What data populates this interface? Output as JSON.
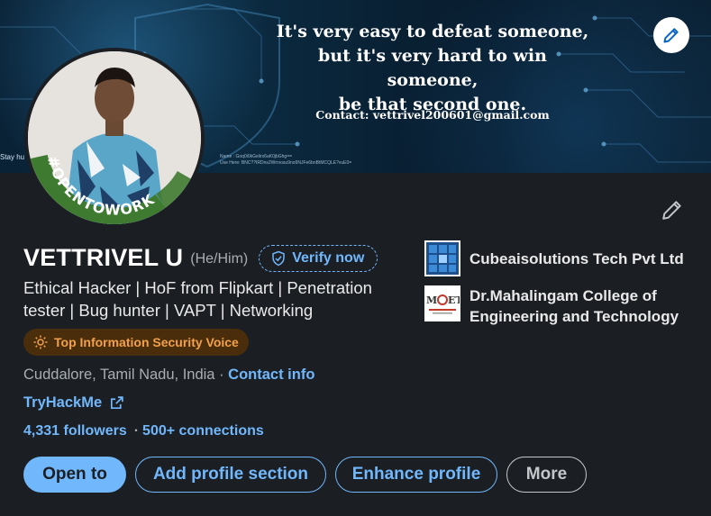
{
  "banner": {
    "quote_lines": [
      "It's very easy to defeat someone,",
      "but it's very hard to win someone,",
      "be that second one."
    ],
    "contact": "Contact: vettrivel200601@gmail.com",
    "stay_text": "Stay hu",
    "tiny_text": "Name : Goq0i0kGelirx6aK0jbGhg==\nUse Here: BNC??IRDns2Wrrvosu9no9NJFe6bnBtMCQLE?vuE0=",
    "edit_icon": "pencil-icon"
  },
  "avatar": {
    "badge": "#OPENTOWORK"
  },
  "profile": {
    "name": "VETTRIVEL U",
    "pronouns": "(He/Him)",
    "verify_label": "Verify now",
    "headline": "Ethical Hacker | HoF from Flipkart | Penetration tester | Bug hunter | VAPT | Networking",
    "voice_badge": "Top Information Security Voice",
    "location": "Cuddalore, Tamil Nadu, India · ",
    "contact_info": "Contact info",
    "website": "TryHackMe",
    "followers": "4,331 followers",
    "connections": "500+ connections",
    "dot": "·"
  },
  "actions": {
    "open_to": "Open to",
    "add_section": "Add profile section",
    "enhance": "Enhance profile",
    "more": "More"
  },
  "orgs": [
    {
      "name": "Cubeaisolutions Tech Pvt Ltd"
    },
    {
      "name": "Dr.Mahalingam College of Engineering and Technology"
    }
  ],
  "colors": {
    "background": "#1b1f23",
    "accent": "#71b7fb",
    "badge_bg": "#4a2d0b",
    "badge_text": "#f2a14a",
    "opentowork_ring": "#3e7a30"
  }
}
